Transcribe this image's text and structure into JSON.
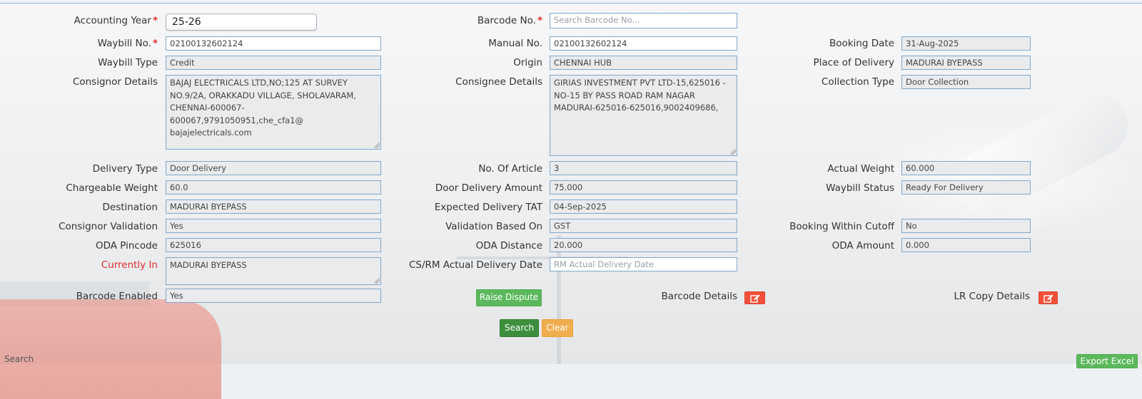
{
  "form": {
    "accounting_year": {
      "label": "Accounting Year",
      "value": "25-26"
    },
    "barcode_no": {
      "label": "Barcode No.",
      "placeholder": "Search Barcode No..."
    },
    "waybill_no": {
      "label": "Waybill No.",
      "value": "02100132602124"
    },
    "manual_no": {
      "label": "Manual No.",
      "value": "02100132602124"
    },
    "booking_date": {
      "label": "Booking Date",
      "value": "31-Aug-2025"
    },
    "waybill_type": {
      "label": "Waybill Type",
      "value": "Credit"
    },
    "origin": {
      "label": "Origin",
      "value": "CHENNAI HUB"
    },
    "place_of_delivery": {
      "label": "Place of Delivery",
      "value": "MADURAI BYEPASS"
    },
    "consignor_details": {
      "label": "Consignor Details",
      "value": "BAJAJ ELECTRICALS LTD,NO;125 AT SURVEY\nNO.9/2A, ORAKKADU VILLAGE, SHOLAVARAM,\nCHENNAI-600067-600067,9791050951,che_cfa1@\nbajajelectricals.com"
    },
    "consignee_details": {
      "label": "Consignee Details",
      "value": "GIRIAS INVESTMENT PVT LTD-15,625016 -\nNO-15 BY PASS ROAD RAM NAGAR\nMADURAI-625016-625016,9002409686,"
    },
    "collection_type": {
      "label": "Collection Type",
      "value": "Door Collection"
    },
    "delivery_type": {
      "label": "Delivery Type",
      "value": "Door Delivery"
    },
    "no_of_article": {
      "label": "No. Of Article",
      "value": "3"
    },
    "actual_weight": {
      "label": "Actual Weight",
      "value": "60.000"
    },
    "chargeable_weight": {
      "label": "Chargeable Weight",
      "value": "60.0"
    },
    "door_delivery_amount": {
      "label": "Door Delivery Amount",
      "value": "75.000"
    },
    "waybill_status": {
      "label": "Waybill Status",
      "value": "Ready For Delivery"
    },
    "destination": {
      "label": "Destination",
      "value": "MADURAI BYEPASS"
    },
    "expected_delivery_tat": {
      "label": "Expected Delivery TAT",
      "value": "04-Sep-2025"
    },
    "consignor_validation": {
      "label": "Consignor Validation",
      "value": "Yes"
    },
    "validation_based_on": {
      "label": "Validation Based On",
      "value": "GST"
    },
    "booking_within_cutoff": {
      "label": "Booking Within Cutoff",
      "value": "No"
    },
    "oda_pincode": {
      "label": "ODA Pincode",
      "value": "625016"
    },
    "oda_distance": {
      "label": "ODA Distance",
      "value": "20.000"
    },
    "oda_amount": {
      "label": "ODA Amount",
      "value": "0.000"
    },
    "currently_in": {
      "label": "Currently In",
      "value": "MADURAI BYEPASS"
    },
    "cs_rm_actual_delivery_date": {
      "label": "CS/RM Actual Delivery Date",
      "placeholder": "RM Actual Delivery Date"
    },
    "barcode_enabled": {
      "label": "Barcode Enabled",
      "value": "Yes"
    },
    "barcode_details": {
      "label": "Barcode Details"
    },
    "lr_copy_details": {
      "label": "LR Copy Details"
    }
  },
  "required_mark": "*",
  "buttons": {
    "raise_dispute": "Raise Dispute",
    "search": "Search",
    "clear": "Clear",
    "export_excel": "Export Excel"
  },
  "footer": {
    "search_label": "Search"
  },
  "icons": {
    "edit": "edit-icon"
  },
  "colors": {
    "required": "#e12b2b",
    "field_border": "#7fa8cc",
    "green": "#5cb85c",
    "orange": "#f0ad4e",
    "red_button": "#f2503a"
  }
}
